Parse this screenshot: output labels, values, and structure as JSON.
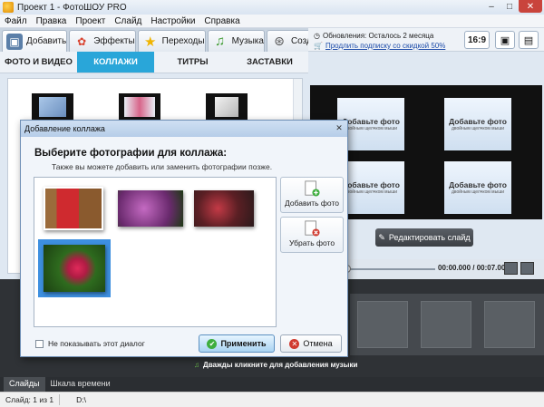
{
  "window": {
    "title": "Проект 1 - ФотоШОУ PRO",
    "minimize": "–",
    "maximize": "□",
    "close": "✕"
  },
  "menu": [
    "Файл",
    "Правка",
    "Проект",
    "Слайд",
    "Настройки",
    "Справка"
  ],
  "top_tabs": [
    {
      "label": "Добавить",
      "icon": "add-photos-icon"
    },
    {
      "label": "Эффекты",
      "icon": "effects-palette-icon"
    },
    {
      "label": "Переходы",
      "icon": "transitions-star-icon"
    },
    {
      "label": "Музыка",
      "icon": "music-note-icon"
    },
    {
      "label": "Создать",
      "icon": "create-film-icon"
    }
  ],
  "sub_tabs": [
    "ФОТО И ВИДЕО",
    "КОЛЛАЖИ",
    "ТИТРЫ",
    "ЗАСТАВКИ"
  ],
  "sub_tab_active": "КОЛЛАЖИ",
  "header": {
    "updates": "Обновления: Осталось 2 месяца",
    "renew_link": "Продлить подписку со скидкой 50%",
    "ratio": "16:9"
  },
  "preview": {
    "placeholder_title": "Добавьте фото",
    "placeholder_sub": "двойным щелчком мыши",
    "edit_slide": "Редактировать слайд",
    "timecode": "00:00.000 / 00:07.000"
  },
  "timeline": {
    "music_hint": "Дважды кликните для добавления музыки"
  },
  "bottom_tabs": [
    "Слайды",
    "Шкала времени"
  ],
  "status": {
    "slide": "Слайд: 1 из 1",
    "path": "D:\\"
  },
  "dialog": {
    "title": "Добавление коллажа",
    "heading": "Выберите фотографии для коллажа:",
    "subheading": "Также вы можете добавить или заменить фотографии позже.",
    "add_photo": "Добавить фото",
    "remove_photo": "Убрать фото",
    "dont_show": "Не показывать этот диалог",
    "dont_show_checked": false,
    "apply": "Применить",
    "cancel": "Отмена",
    "close": "✕"
  },
  "colors": {
    "accent_tab": "#29a6d9",
    "dialog_border": "#6f8fb5",
    "apply_button": "#a9d3f2"
  }
}
